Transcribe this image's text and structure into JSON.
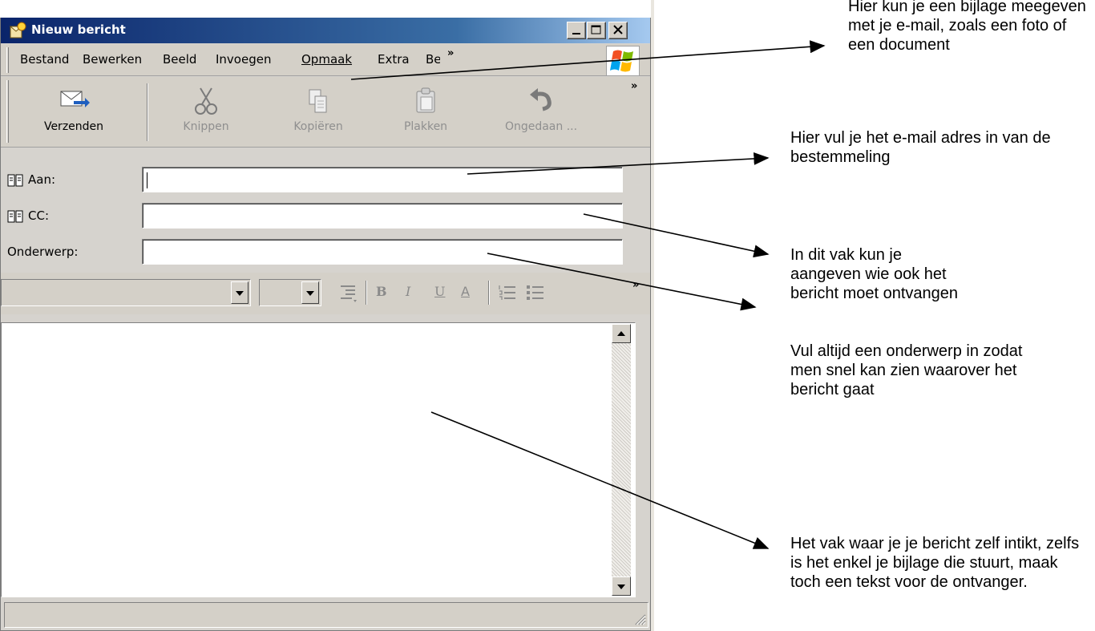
{
  "window": {
    "title": "Nieuw bericht"
  },
  "menu": {
    "items": [
      "Bestand",
      "Bewerken",
      "Beeld",
      "Invoegen",
      "Opmaak",
      "Extra",
      "Be"
    ],
    "overflow": "»"
  },
  "toolbar": {
    "buttons": [
      {
        "label": "Verzenden",
        "icon": "send-icon",
        "enabled": true
      },
      {
        "label": "Knippen",
        "icon": "scissors-icon",
        "enabled": false
      },
      {
        "label": "Kopiëren",
        "icon": "copy-icon",
        "enabled": false
      },
      {
        "label": "Plakken",
        "icon": "paste-icon",
        "enabled": false
      },
      {
        "label": "Ongedaan ...",
        "icon": "undo-icon",
        "enabled": false
      }
    ],
    "overflow": "»"
  },
  "fields": {
    "to_label": "Aan:",
    "to_value": "",
    "cc_label": "CC:",
    "cc_value": "",
    "subject_label": "Onderwerp:",
    "subject_value": ""
  },
  "formatting": {
    "bold": "B",
    "italic": "I",
    "underline": "U",
    "font_color": "A",
    "overflow": "»"
  },
  "body": {
    "text": ""
  },
  "annotations": {
    "attachment": "Hier kun je een bijlage meegeven met je e-mail, zoals een foto of een document",
    "recipient": "Hier vul je het e-mail adres in van de bestemmeling",
    "cc": "In dit vak kun je aangeven wie ook het bericht moet ontvangen",
    "subject": "Vul altijd een onderwerp in zodat men snel kan zien waarover het bericht gaat",
    "body": "Het vak waar je je bericht zelf intikt, zelfs is het enkel je bijlage die stuurt, maak toch een tekst voor de ontvanger."
  },
  "colors": {
    "titlebar": "#0a246a",
    "window_face": "#d4d0c8"
  }
}
